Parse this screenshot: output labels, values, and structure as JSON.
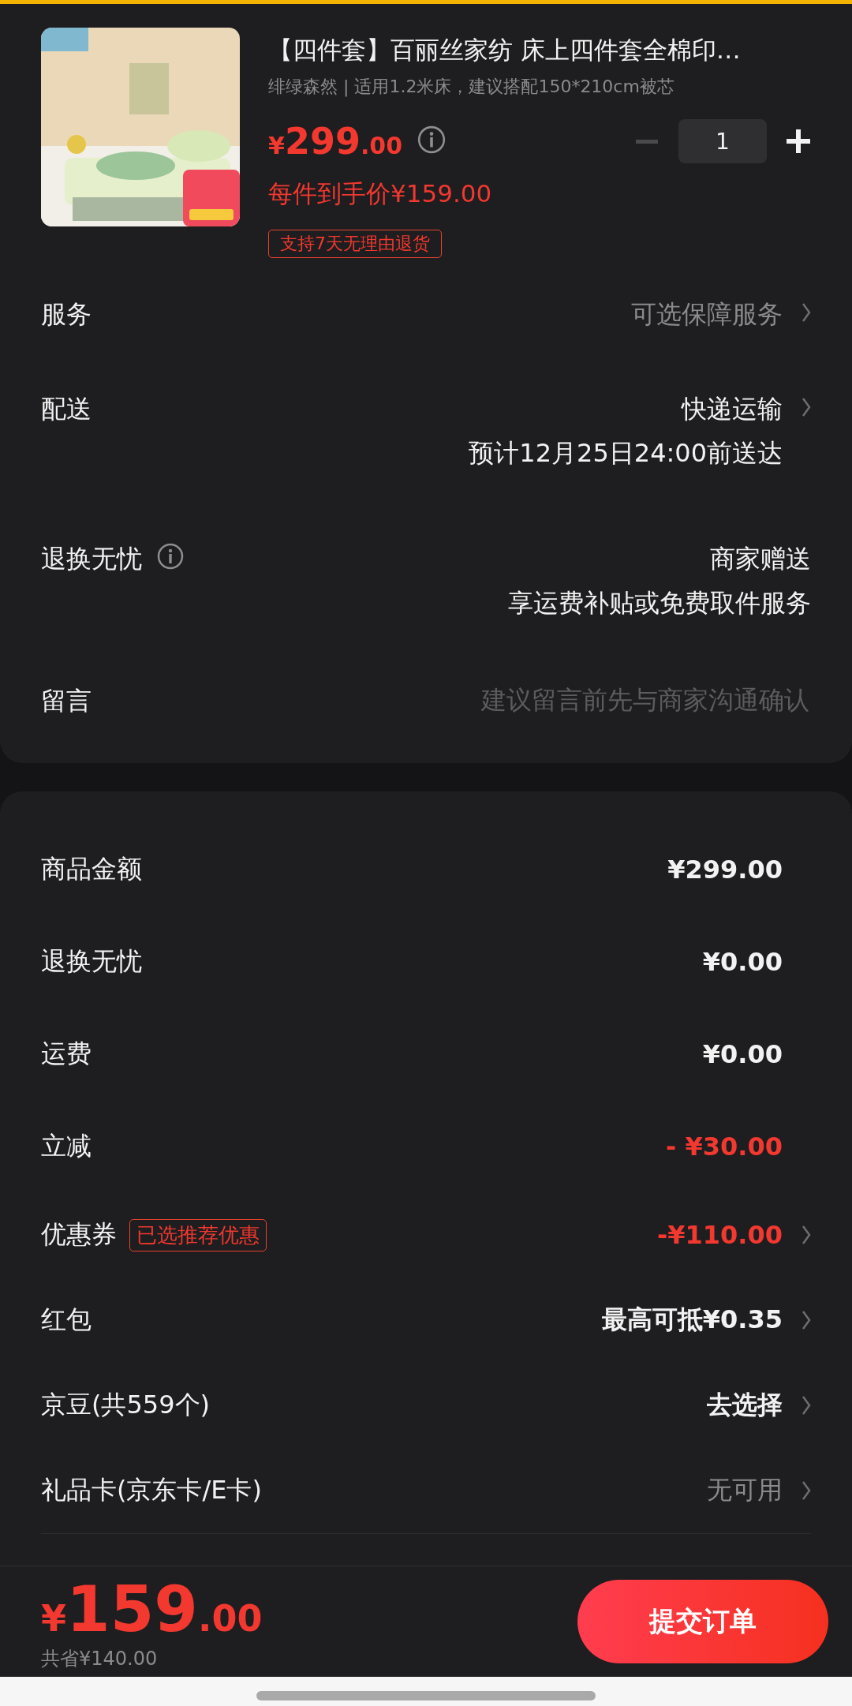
{
  "product": {
    "kind": "picture",
    "title": "【四件套】百丽丝家纺 床上四件套全棉印…",
    "spec": "绯绿森然 | 适用1.2米床，建议搭配150*210cm被芯",
    "price_symbol": "¥",
    "price_int": "299",
    "price_dec": ".00",
    "final_price": "每件到手价¥159.00",
    "quantity": "1",
    "minus_disabled": true,
    "tag": "支持7天无理由退货"
  },
  "services": [
    {
      "kind": "link",
      "label": "服务",
      "value": "可选保障服务",
      "muted": true,
      "chevron": true
    },
    {
      "kind": "link",
      "label": "配送",
      "value": "快递运输",
      "sub": "预计12月25日24:00前送达",
      "muted": false,
      "chevron": true
    },
    {
      "kind": "info",
      "label": "退换无忧",
      "value": "商家赠送",
      "sub": "享运费补贴或免费取件服务",
      "muted": false,
      "chevron": false
    },
    {
      "kind": "input",
      "label": "留言",
      "placeholder": "建议留言前先与商家沟通确认"
    }
  ],
  "summary": [
    {
      "label": "商品金额",
      "value": "¥299.00",
      "discount": false,
      "muted": false,
      "chevron": false
    },
    {
      "label": "退换无忧",
      "value": "¥0.00",
      "discount": false,
      "muted": false,
      "chevron": false
    },
    {
      "label": "运费",
      "value": "¥0.00",
      "discount": false,
      "muted": false,
      "chevron": false
    },
    {
      "label": "立减",
      "value": "- ¥30.00",
      "discount": true,
      "muted": false,
      "chevron": false
    },
    {
      "label": "优惠券",
      "tag": "已选推荐优惠",
      "value": "-¥110.00",
      "discount": true,
      "muted": false,
      "chevron": true
    },
    {
      "label": "红包",
      "value": "最高可抵¥0.35",
      "discount": false,
      "muted": false,
      "chevron": true
    },
    {
      "label": "京豆(共559个)",
      "value": "去选择",
      "discount": false,
      "muted": false,
      "chevron": true
    },
    {
      "label": "礼品卡(京东卡/E卡)",
      "value": "无可用",
      "discount": false,
      "muted": true,
      "chevron": true
    }
  ],
  "footer": {
    "symbol": "¥",
    "int": "159",
    "dec": ".00",
    "saved": "共省¥140.00",
    "submit": "提交订单"
  }
}
